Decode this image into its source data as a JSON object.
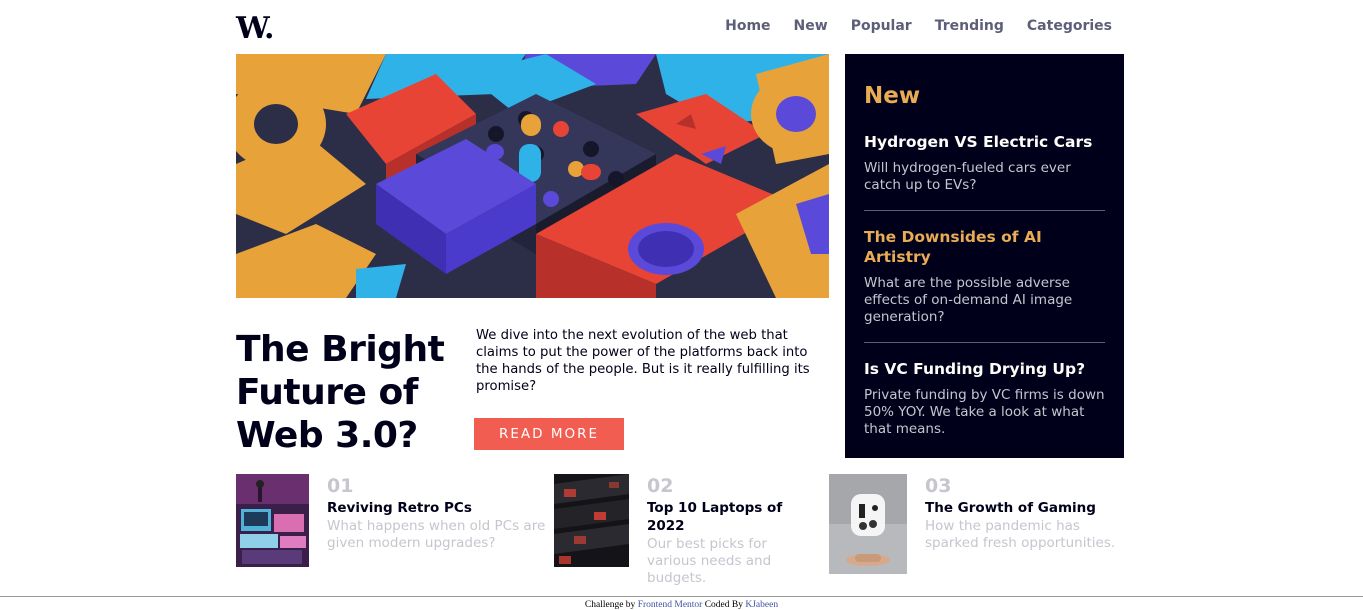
{
  "logo": "W.",
  "nav": [
    "Home",
    "New",
    "Popular",
    "Trending",
    "Categories"
  ],
  "hero": {
    "headline": "The Bright Future of Web 3.0?",
    "description": "We dive into the next evolution of the web that claims to put the power of the platforms back into the hands of the people. But is it really fulfilling its promise?",
    "button": "READ MORE"
  },
  "new_panel": {
    "title": "New",
    "items": [
      {
        "title": "Hydrogen VS Electric Cars",
        "text": "Will hydrogen-fueled cars ever catch up to EVs?"
      },
      {
        "title": "The Downsides of AI Artistry",
        "text": "What are the possible adverse effects of on-demand AI image generation?"
      },
      {
        "title": "Is VC Funding Drying Up?",
        "text": "Private funding by VC firms is down 50% YOY. We take a look at what that means."
      }
    ]
  },
  "cards": [
    {
      "num": "01",
      "title": "Reviving Retro PCs",
      "text": "What happens when old PCs are given modern upgrades?"
    },
    {
      "num": "02",
      "title": "Top 10 Laptops of 2022",
      "text": "Our best picks for various needs and budgets."
    },
    {
      "num": "03",
      "title": "The Growth of Gaming",
      "text": "How the pandemic has sparked fresh opportunities."
    }
  ],
  "footer": {
    "prefix": "Challenge by",
    "challenge_link": "Frontend Mentor",
    "middle": "Coded By",
    "author_link": "KJabeen"
  },
  "colors": {
    "accent_red": "#f15d51",
    "accent_orange": "#e9ab53",
    "dark_navy": "#00001a",
    "grayish_blue": "#5d5f79"
  }
}
